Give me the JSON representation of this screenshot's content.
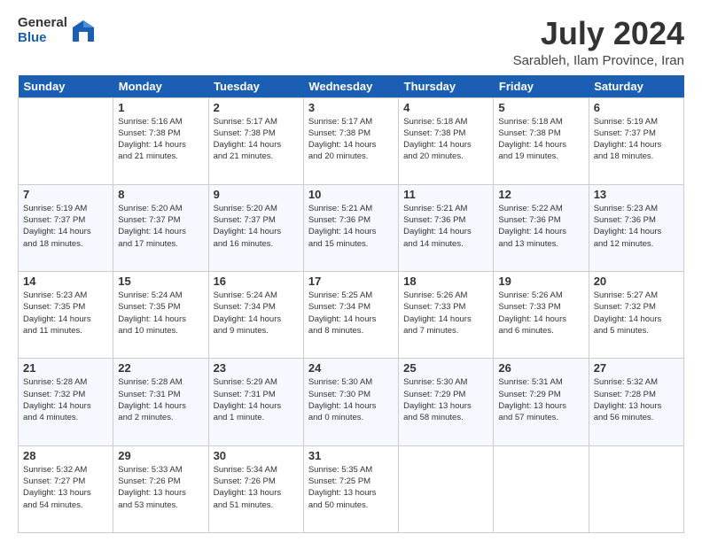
{
  "logo": {
    "general": "General",
    "blue": "Blue"
  },
  "title": "July 2024",
  "location": "Sarableh, Ilam Province, Iran",
  "days": [
    "Sunday",
    "Monday",
    "Tuesday",
    "Wednesday",
    "Thursday",
    "Friday",
    "Saturday"
  ],
  "weeks": [
    [
      {
        "date": "",
        "content": ""
      },
      {
        "date": "1",
        "content": "Sunrise: 5:16 AM\nSunset: 7:38 PM\nDaylight: 14 hours\nand 21 minutes."
      },
      {
        "date": "2",
        "content": "Sunrise: 5:17 AM\nSunset: 7:38 PM\nDaylight: 14 hours\nand 21 minutes."
      },
      {
        "date": "3",
        "content": "Sunrise: 5:17 AM\nSunset: 7:38 PM\nDaylight: 14 hours\nand 20 minutes."
      },
      {
        "date": "4",
        "content": "Sunrise: 5:18 AM\nSunset: 7:38 PM\nDaylight: 14 hours\nand 20 minutes."
      },
      {
        "date": "5",
        "content": "Sunrise: 5:18 AM\nSunset: 7:38 PM\nDaylight: 14 hours\nand 19 minutes."
      },
      {
        "date": "6",
        "content": "Sunrise: 5:19 AM\nSunset: 7:37 PM\nDaylight: 14 hours\nand 18 minutes."
      }
    ],
    [
      {
        "date": "7",
        "content": "Sunrise: 5:19 AM\nSunset: 7:37 PM\nDaylight: 14 hours\nand 18 minutes."
      },
      {
        "date": "8",
        "content": "Sunrise: 5:20 AM\nSunset: 7:37 PM\nDaylight: 14 hours\nand 17 minutes."
      },
      {
        "date": "9",
        "content": "Sunrise: 5:20 AM\nSunset: 7:37 PM\nDaylight: 14 hours\nand 16 minutes."
      },
      {
        "date": "10",
        "content": "Sunrise: 5:21 AM\nSunset: 7:36 PM\nDaylight: 14 hours\nand 15 minutes."
      },
      {
        "date": "11",
        "content": "Sunrise: 5:21 AM\nSunset: 7:36 PM\nDaylight: 14 hours\nand 14 minutes."
      },
      {
        "date": "12",
        "content": "Sunrise: 5:22 AM\nSunset: 7:36 PM\nDaylight: 14 hours\nand 13 minutes."
      },
      {
        "date": "13",
        "content": "Sunrise: 5:23 AM\nSunset: 7:36 PM\nDaylight: 14 hours\nand 12 minutes."
      }
    ],
    [
      {
        "date": "14",
        "content": "Sunrise: 5:23 AM\nSunset: 7:35 PM\nDaylight: 14 hours\nand 11 minutes."
      },
      {
        "date": "15",
        "content": "Sunrise: 5:24 AM\nSunset: 7:35 PM\nDaylight: 14 hours\nand 10 minutes."
      },
      {
        "date": "16",
        "content": "Sunrise: 5:24 AM\nSunset: 7:34 PM\nDaylight: 14 hours\nand 9 minutes."
      },
      {
        "date": "17",
        "content": "Sunrise: 5:25 AM\nSunset: 7:34 PM\nDaylight: 14 hours\nand 8 minutes."
      },
      {
        "date": "18",
        "content": "Sunrise: 5:26 AM\nSunset: 7:33 PM\nDaylight: 14 hours\nand 7 minutes."
      },
      {
        "date": "19",
        "content": "Sunrise: 5:26 AM\nSunset: 7:33 PM\nDaylight: 14 hours\nand 6 minutes."
      },
      {
        "date": "20",
        "content": "Sunrise: 5:27 AM\nSunset: 7:32 PM\nDaylight: 14 hours\nand 5 minutes."
      }
    ],
    [
      {
        "date": "21",
        "content": "Sunrise: 5:28 AM\nSunset: 7:32 PM\nDaylight: 14 hours\nand 4 minutes."
      },
      {
        "date": "22",
        "content": "Sunrise: 5:28 AM\nSunset: 7:31 PM\nDaylight: 14 hours\nand 2 minutes."
      },
      {
        "date": "23",
        "content": "Sunrise: 5:29 AM\nSunset: 7:31 PM\nDaylight: 14 hours\nand 1 minute."
      },
      {
        "date": "24",
        "content": "Sunrise: 5:30 AM\nSunset: 7:30 PM\nDaylight: 14 hours\nand 0 minutes."
      },
      {
        "date": "25",
        "content": "Sunrise: 5:30 AM\nSunset: 7:29 PM\nDaylight: 13 hours\nand 58 minutes."
      },
      {
        "date": "26",
        "content": "Sunrise: 5:31 AM\nSunset: 7:29 PM\nDaylight: 13 hours\nand 57 minutes."
      },
      {
        "date": "27",
        "content": "Sunrise: 5:32 AM\nSunset: 7:28 PM\nDaylight: 13 hours\nand 56 minutes."
      }
    ],
    [
      {
        "date": "28",
        "content": "Sunrise: 5:32 AM\nSunset: 7:27 PM\nDaylight: 13 hours\nand 54 minutes."
      },
      {
        "date": "29",
        "content": "Sunrise: 5:33 AM\nSunset: 7:26 PM\nDaylight: 13 hours\nand 53 minutes."
      },
      {
        "date": "30",
        "content": "Sunrise: 5:34 AM\nSunset: 7:26 PM\nDaylight: 13 hours\nand 51 minutes."
      },
      {
        "date": "31",
        "content": "Sunrise: 5:35 AM\nSunset: 7:25 PM\nDaylight: 13 hours\nand 50 minutes."
      },
      {
        "date": "",
        "content": ""
      },
      {
        "date": "",
        "content": ""
      },
      {
        "date": "",
        "content": ""
      }
    ]
  ]
}
